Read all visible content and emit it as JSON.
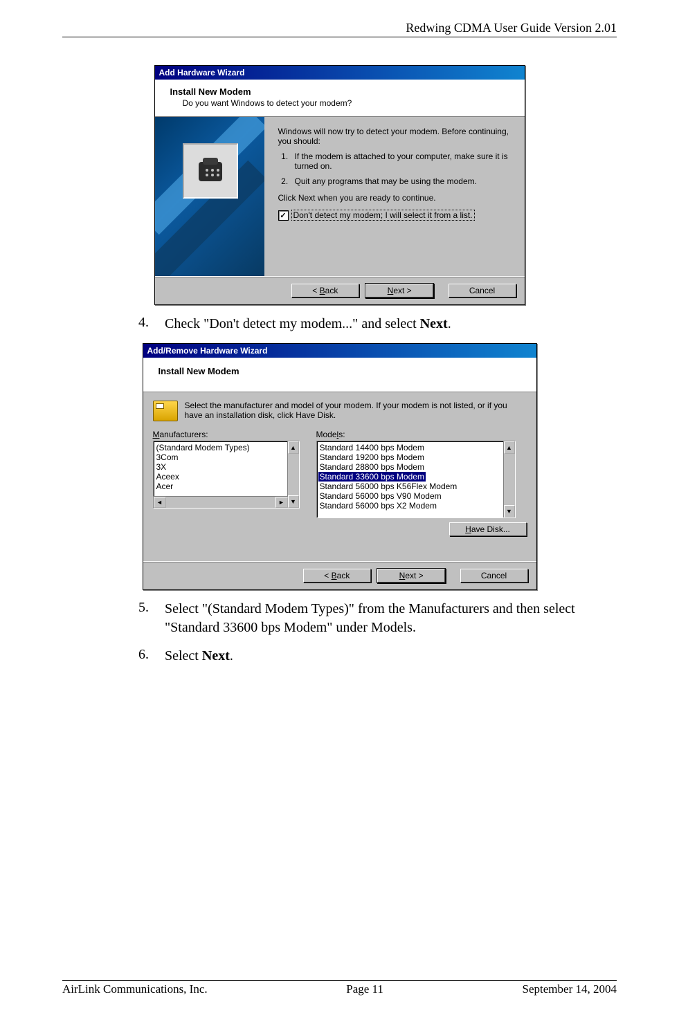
{
  "header": {
    "doc_title": "Redwing CDMA User Guide Version 2.01"
  },
  "footer": {
    "company": "AirLink Communications, Inc.",
    "page": "Page 11",
    "date": "September 14, 2004"
  },
  "steps": {
    "s4": {
      "num": "4.",
      "text_a": "Check \"Don't detect my modem...\" and select ",
      "bold": "Next",
      "text_b": "."
    },
    "s5": {
      "num": "5.",
      "text": "Select \"(Standard Modem Types)\" from the Manufacturers and then select \"Standard 33600 bps Modem\" under Models."
    },
    "s6": {
      "num": "6.",
      "text_a": "Select ",
      "bold": "Next",
      "text_b": "."
    }
  },
  "dlg1": {
    "title": "Add Hardware Wizard",
    "heading": "Install New Modem",
    "subheading": "Do you want Windows to detect your modem?",
    "intro": "Windows will now try to detect your modem.  Before continuing, you should:",
    "li1": "If the modem is attached to your computer, make sure it is turned on.",
    "li2": "Quit any programs that may be using the modem.",
    "continue": "Click Next when you are ready to continue.",
    "checkbox_label": "Don't detect my modem; I will select it from a list.",
    "back_u": "B",
    "back_rest": "ack",
    "next_u": "N",
    "next_rest": "ext >",
    "cancel": "Cancel",
    "lt": "< "
  },
  "dlg2": {
    "title": "Add/Remove Hardware Wizard",
    "heading": "Install New Modem",
    "instr": "Select the manufacturer and model of your modem. If your modem is not listed, or if you have an installation disk, click Have Disk.",
    "mfr_u": "M",
    "mfr_rest": "anufacturers:",
    "mdl_rest_a": "Mode",
    "mdl_u": "l",
    "mdl_rest_b": "s:",
    "mfrs": {
      "m0": "(Standard Modem Types)",
      "m1": "3Com",
      "m2": "3X",
      "m3": "Aceex",
      "m4": "Acer"
    },
    "models": {
      "d0": "Standard 14400 bps Modem",
      "d1": "Standard 19200 bps Modem",
      "d2": "Standard 28800 bps Modem",
      "d3": "Standard 33600 bps Modem",
      "d4": "Standard 56000 bps K56Flex Modem",
      "d5": "Standard 56000 bps V90 Modem",
      "d6": "Standard 56000 bps X2 Modem"
    },
    "have_u": "H",
    "have_rest": "ave Disk...",
    "back_u": "B",
    "back_rest": "ack",
    "next_u": "N",
    "next_rest": "ext >",
    "cancel": "Cancel",
    "lt": "< "
  },
  "glyphs": {
    "check": "✓",
    "up": "▲",
    "down": "▼",
    "left": "◄",
    "right": "►"
  }
}
